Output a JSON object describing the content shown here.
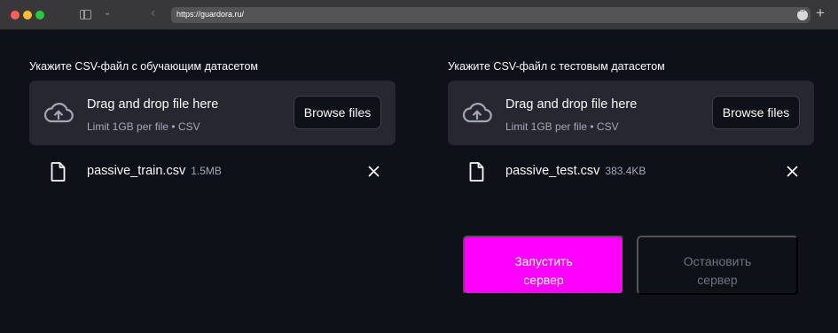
{
  "browser": {
    "url": "https://guardora.ru/"
  },
  "train_upload": {
    "label": "Укажите CSV-файл с обучающим датасетом",
    "drop_title": "Drag and drop file here",
    "drop_limit": "Limit 1GB per file • CSV",
    "browse_label": "Browse files",
    "file": {
      "name": "passive_train.csv",
      "size": "1.5MB"
    }
  },
  "test_upload": {
    "label": "Укажите CSV-файл с тестовым датасетом",
    "drop_title": "Drag and drop file here",
    "drop_limit": "Limit 1GB per file • CSV",
    "browse_label": "Browse files",
    "file": {
      "name": "passive_test.csv",
      "size": "383.4KB"
    }
  },
  "actions": {
    "start_line1": "Запустить",
    "start_line2": "сервер",
    "stop_line1": "Остановить",
    "stop_line2": "сервер"
  },
  "colors": {
    "background": "#0e1117",
    "dropzone": "#262730",
    "accent": "#ff00ff",
    "muted_text": "#a3a8b8"
  },
  "icons": {
    "upload": "cloud-upload-icon",
    "file": "file-icon",
    "remove": "close-icon"
  }
}
